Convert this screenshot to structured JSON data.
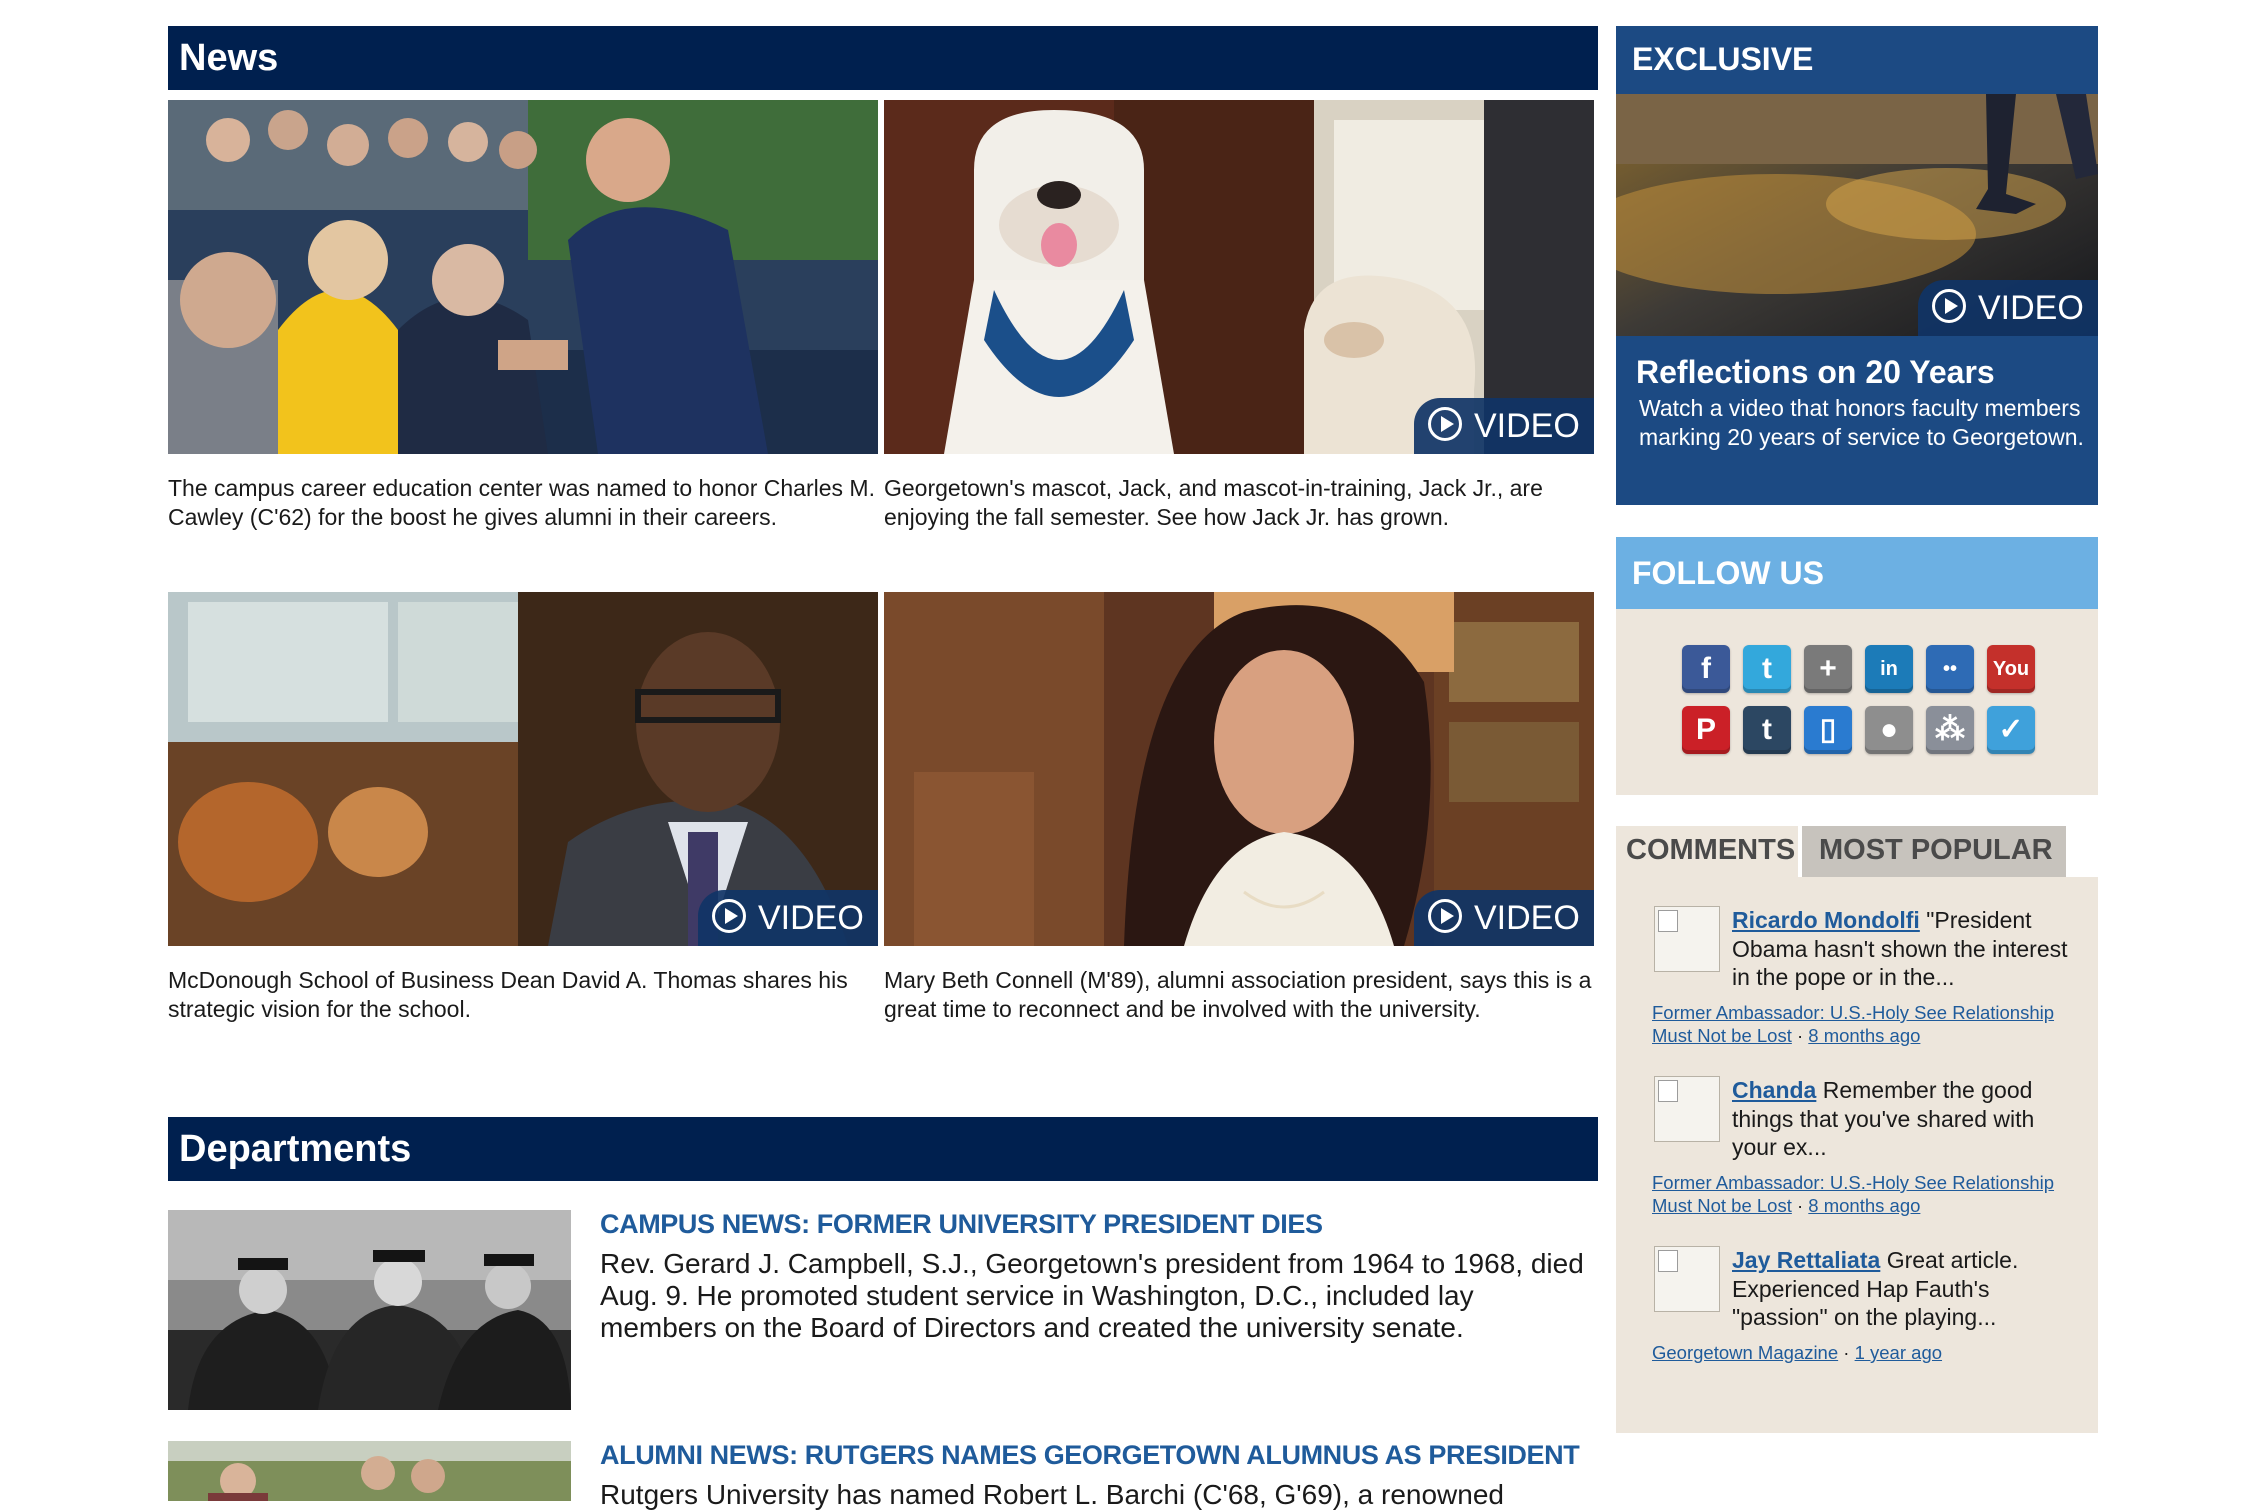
{
  "news": {
    "heading": "News",
    "video_label": "VIDEO",
    "items": [
      {
        "caption": "The campus career education center was named to honor Charles M. Cawley (C'62) for the boost he gives alumni in their careers."
      },
      {
        "caption": "Georgetown's mascot, Jack, and mascot-in-training, Jack Jr., are enjoying the fall semester. See how Jack Jr. has grown."
      },
      {
        "caption": "McDonough School of Business Dean David A. Thomas shares his strategic vision for the school."
      },
      {
        "caption": "Mary Beth Connell (M'89), alumni association president, says this is a great time to reconnect and be involved with the university."
      }
    ]
  },
  "departments": {
    "heading": "Departments",
    "items": [
      {
        "title": "CAMPUS NEWS: FORMER UNIVERSITY PRESIDENT DIES",
        "body": "Rev. Gerard J. Campbell, S.J., Georgetown's president from 1964 to 1968, died Aug. 9. He promoted student service in Washington, D.C., included lay members on the Board of Directors and created the university senate."
      },
      {
        "title": "ALUMNI NEWS: RUTGERS NAMES GEORGETOWN ALUMNUS AS PRESIDENT",
        "body": "Rutgers University has named Robert L. Barchi (C'68, G'69), a renowned"
      }
    ]
  },
  "exclusive": {
    "heading": "EXCLUSIVE",
    "video_label": "VIDEO",
    "title": "Reflections on 20 Years",
    "text": "Watch a video that honors faculty members marking 20 years of service to Georgetown."
  },
  "follow": {
    "heading": "FOLLOW US",
    "icons": [
      {
        "name": "facebook-icon",
        "glyph": "f",
        "color": "#3b5998"
      },
      {
        "name": "twitter-icon",
        "glyph": "t",
        "color": "#33a8dc"
      },
      {
        "name": "google-plus-icon",
        "glyph": "+",
        "color": "#7a7a7a"
      },
      {
        "name": "linkedin-icon",
        "glyph": "in",
        "color": "#1c7bb8"
      },
      {
        "name": "flickr-icon",
        "glyph": "••",
        "color": "#2e6bb5"
      },
      {
        "name": "youtube-icon",
        "glyph": "You",
        "color": "#c4302b"
      },
      {
        "name": "pinterest-icon",
        "glyph": "P",
        "color": "#cb2027"
      },
      {
        "name": "tumblr-icon",
        "glyph": "t",
        "color": "#2c4762"
      },
      {
        "name": "mobile-icon",
        "glyph": "▯",
        "color": "#2a7bd0"
      },
      {
        "name": "apple-icon",
        "glyph": "●",
        "color": "#8e8e8e"
      },
      {
        "name": "app-grid-icon",
        "glyph": "⁂",
        "color": "#8a8f99"
      },
      {
        "name": "foursquare-icon",
        "glyph": "✓",
        "color": "#3fa1db"
      }
    ]
  },
  "comments": {
    "tabs": [
      "COMMENTS",
      "MOST POPULAR"
    ],
    "items": [
      {
        "author": "Ricardo Mondolfi",
        "text": "\"President Obama hasn't shown the interest in the pope or in the...",
        "article_line1": "Former Ambassador: U.S.-Holy See Relationship",
        "article_line2": "Must Not be Lost",
        "time": "8 months ago"
      },
      {
        "author": "Chanda",
        "text": "Remember the good things that you've shared with your ex...",
        "article_line1": "Former Ambassador: U.S.-Holy See Relationship",
        "article_line2": "Must Not be Lost",
        "time": "8 months ago"
      },
      {
        "author": "Jay Rettaliata",
        "text": "Great article. Experienced Hap Fauth's \"passion\" on the playing...",
        "article_line1": "Georgetown Magazine",
        "article_line2": "",
        "time": "1 year ago"
      }
    ]
  }
}
